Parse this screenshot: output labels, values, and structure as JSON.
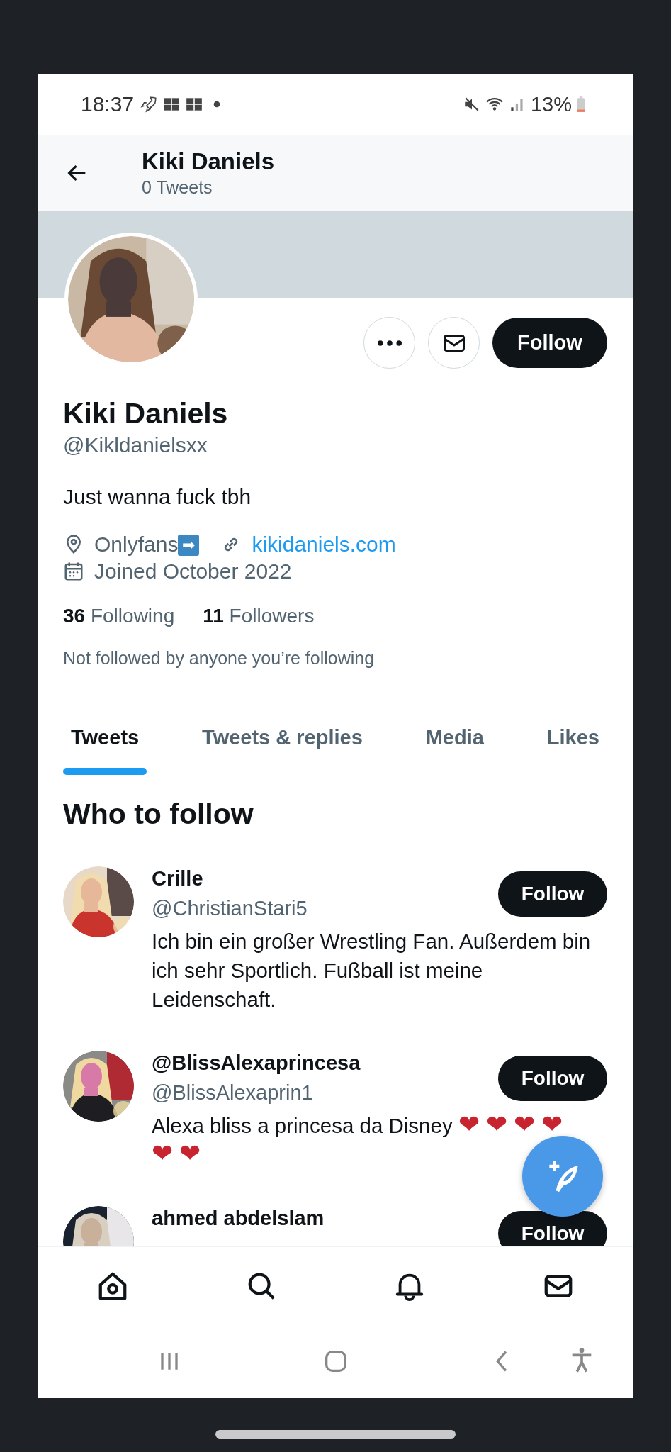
{
  "status_bar": {
    "time": "18:37",
    "battery": "13%"
  },
  "header": {
    "title": "Kiki Daniels",
    "subtitle": "0 Tweets"
  },
  "profile": {
    "name": "Kiki Daniels",
    "handle": "@Kikldanielsxx",
    "follow_button": "Follow",
    "bio": "Just wanna fuck tbh",
    "location": "Onlyfans➡",
    "website": "kikidaniels.com",
    "joined": "Joined October 2022",
    "following_count": "36",
    "following_label": "Following",
    "followers_count": "11",
    "followers_label": "Followers",
    "mutuals": "Not followed by anyone you’re following"
  },
  "tabs": [
    {
      "label": "Tweets",
      "selected": true
    },
    {
      "label": "Tweets & replies",
      "selected": false
    },
    {
      "label": "Media",
      "selected": false
    },
    {
      "label": "Likes",
      "selected": false
    }
  ],
  "who_to_follow": {
    "title": "Who to follow",
    "accounts": [
      {
        "name": "Crille",
        "handle": "@ChristianStari5",
        "bio": "Ich bin ein großer Wrestling Fan. Außerdem bin ich sehr Sportlich. Fußball ist meine Leidenschaft.",
        "button": "Follow"
      },
      {
        "name": "@BlissAlexaprincesa",
        "handle": "@BlissAlexaprin1",
        "bio": "Alexa bliss a princesa da Disney",
        "emoji": [
          "❤❤❤❤",
          "❤❤"
        ],
        "button": "Follow"
      },
      {
        "name": "ahmed abdelslam",
        "button": "Follow"
      }
    ]
  }
}
